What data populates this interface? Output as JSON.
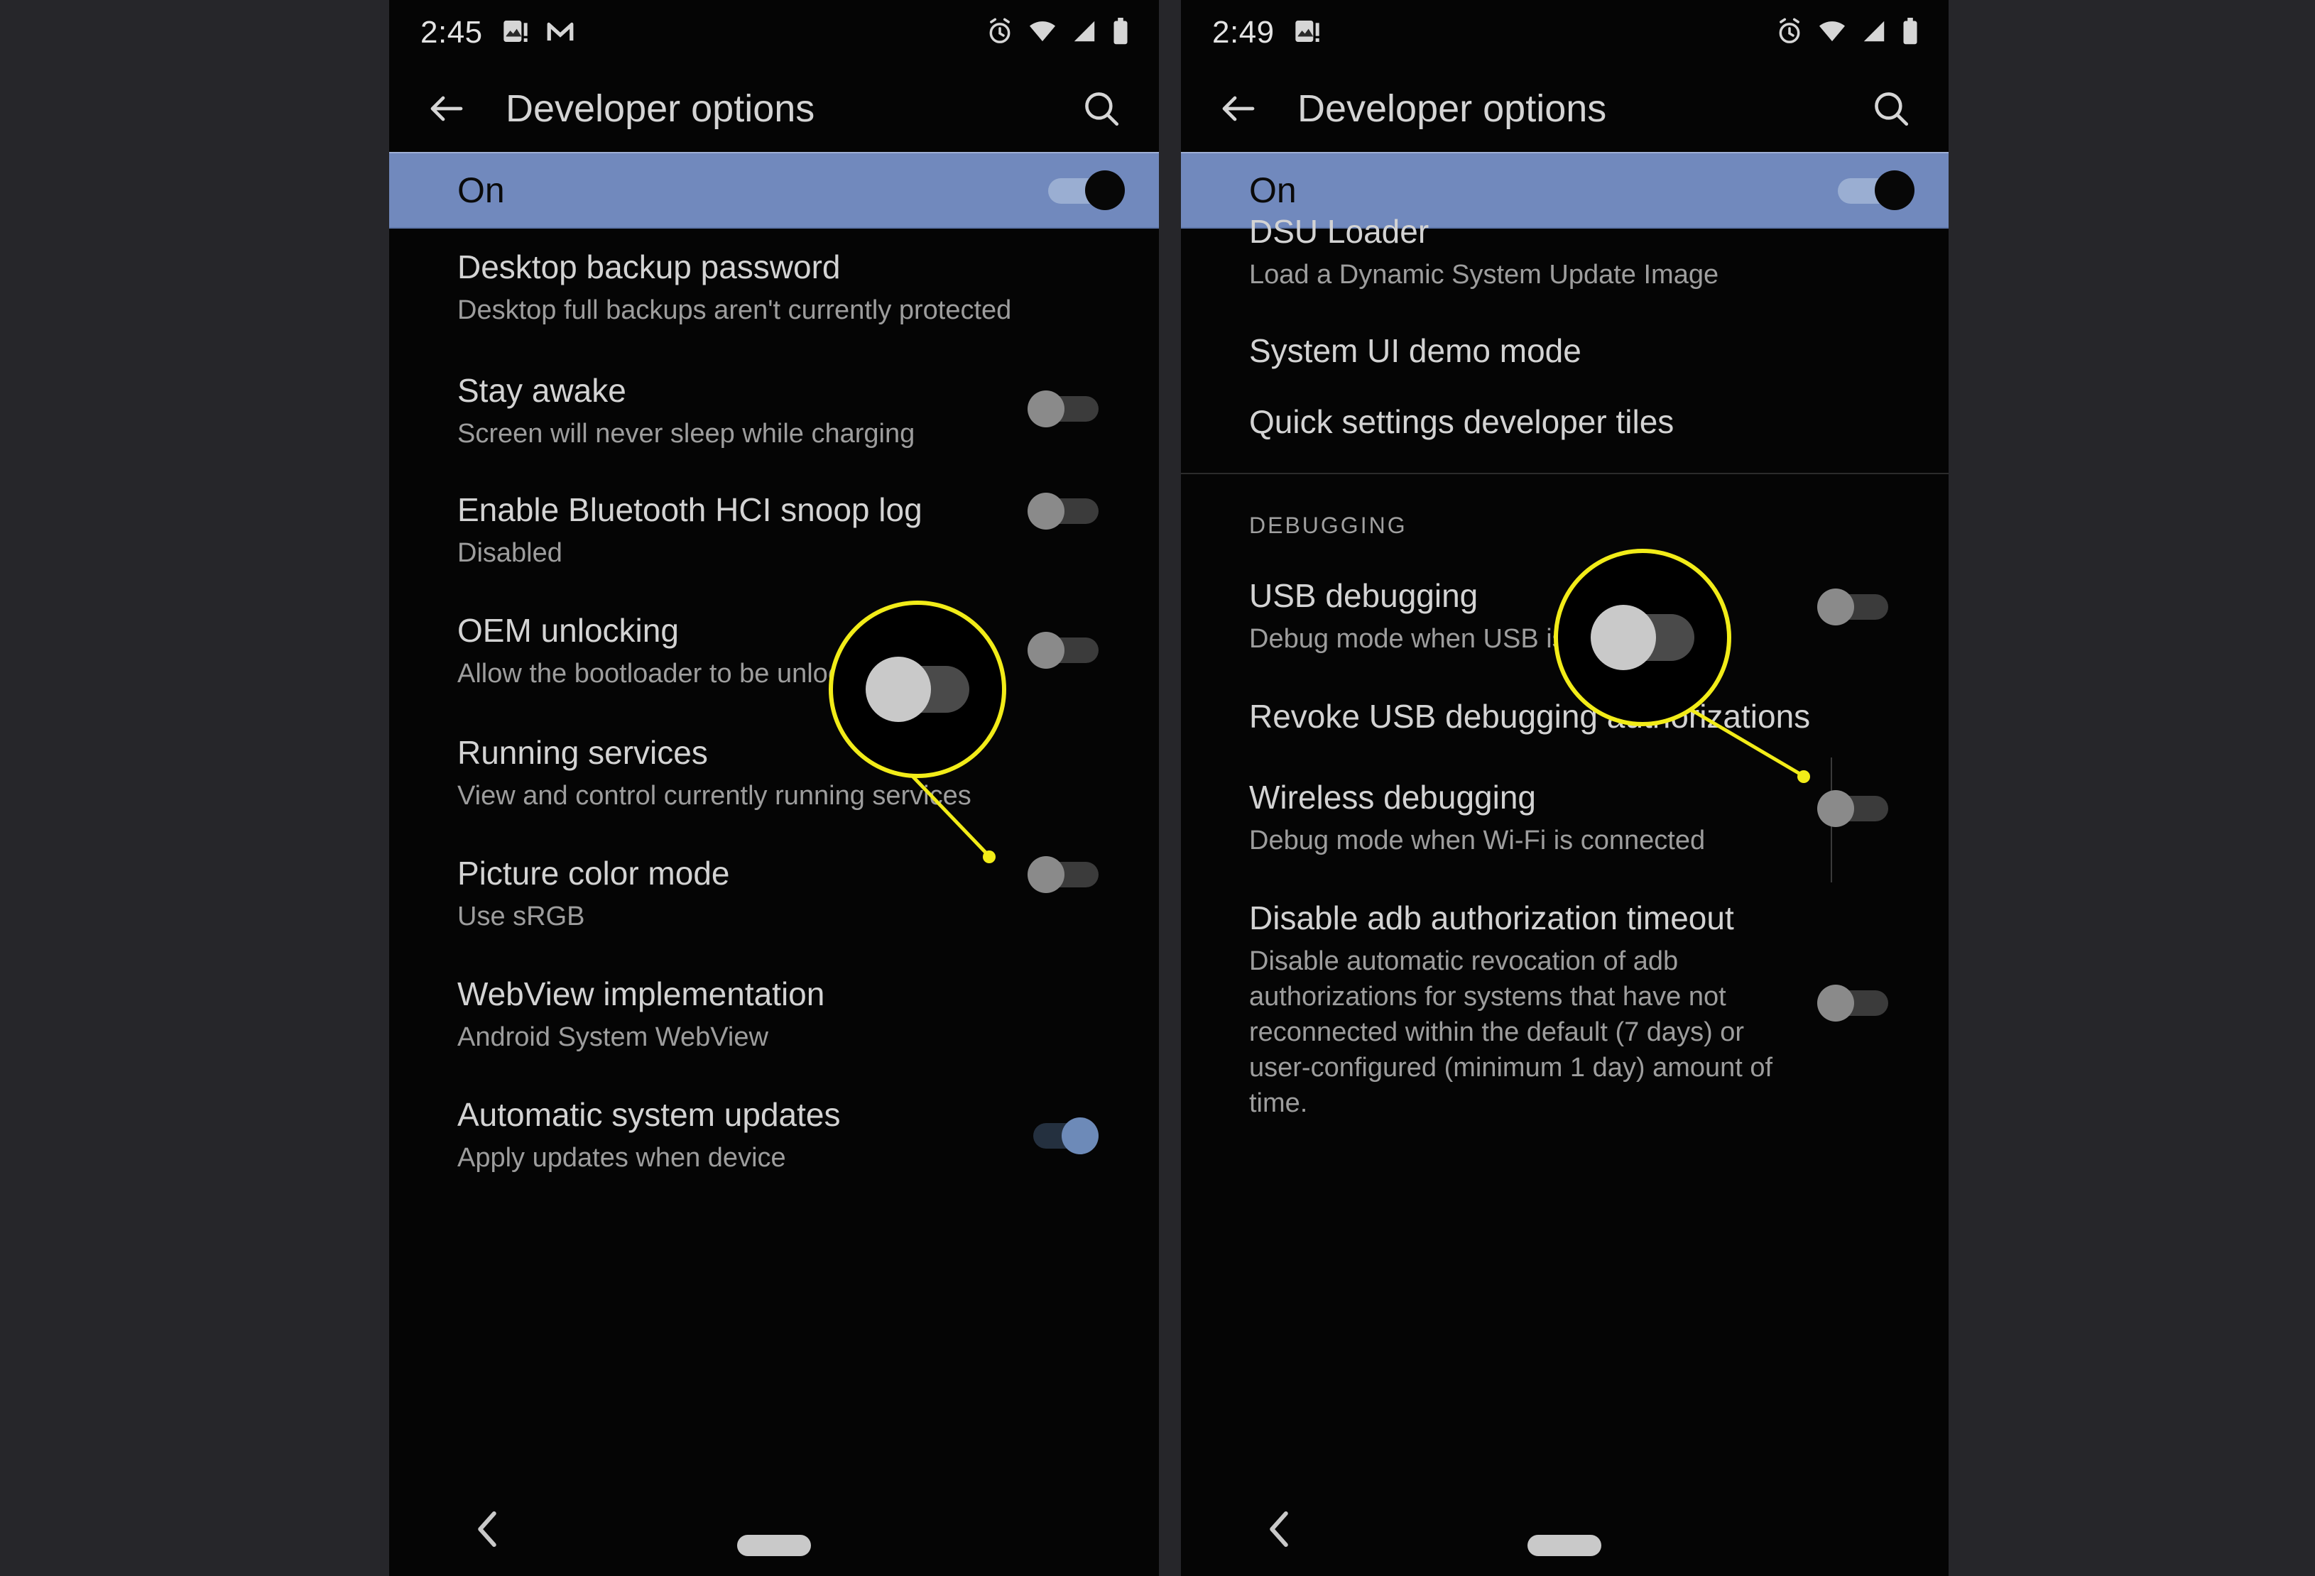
{
  "background_color": "#26262a",
  "accent_highlight": "#f2ec18",
  "master_bar_color": "#7189bd",
  "toggle_on_color": "#6d8ab8",
  "panels": [
    {
      "id": "left",
      "status_bar": {
        "time": "2:45",
        "left_icons": [
          "screenshot-icon",
          "gmail-icon"
        ],
        "right_icons": [
          "alarm-icon",
          "wifi-icon",
          "signal-icon",
          "battery-icon"
        ]
      },
      "action_bar": {
        "back_icon": "arrow-back-icon",
        "title": "Developer options",
        "search_icon": "search-icon"
      },
      "master_switch": {
        "label": "On",
        "state": "on"
      },
      "items": [
        {
          "title": "Desktop backup password",
          "summary": "Desktop full backups aren't currently protected",
          "switch": null
        },
        {
          "title": "Stay awake",
          "summary": "Screen will never sleep while charging",
          "switch": "off"
        },
        {
          "title": "Enable Bluetooth HCI snoop log",
          "summary": "Disabled",
          "switch": "off"
        },
        {
          "title": "OEM unlocking",
          "summary": "Allow the bootloader to be unlocked",
          "switch": "off"
        },
        {
          "title": "Running services",
          "summary": "View and control currently running services",
          "switch": null
        },
        {
          "title": "Picture color mode",
          "summary": "Use sRGB",
          "switch": "off"
        },
        {
          "title": "WebView implementation",
          "summary": "Android System WebView",
          "switch": null
        },
        {
          "title": "Automatic system updates",
          "summary": "Apply updates when device",
          "switch": "on"
        }
      ],
      "callout": {
        "magnified_switch_state": "off",
        "points_to": "OEM unlocking switch"
      },
      "nav_bar": {
        "back_icon": "nav-back-chevron-icon",
        "home_icon": "nav-home-pill-icon"
      }
    },
    {
      "id": "right",
      "status_bar": {
        "time": "2:49",
        "left_icons": [
          "screenshot-icon"
        ],
        "right_icons": [
          "alarm-icon",
          "wifi-icon",
          "signal-icon",
          "battery-icon"
        ]
      },
      "action_bar": {
        "back_icon": "arrow-back-icon",
        "title": "Developer options",
        "search_icon": "search-icon"
      },
      "master_switch": {
        "label": "On",
        "state": "on"
      },
      "items": [
        {
          "title": "DSU Loader",
          "summary": "Load a Dynamic System Update Image",
          "switch": null
        },
        {
          "title": "System UI demo mode",
          "summary": "",
          "switch": null
        },
        {
          "title": "Quick settings developer tiles",
          "summary": "",
          "switch": null
        }
      ],
      "section_header": "DEBUGGING",
      "debug_items": [
        {
          "title": "USB debugging",
          "summary": "Debug mode when USB is connected",
          "switch": "off"
        },
        {
          "title": "Revoke USB debugging authorizations",
          "summary": "",
          "switch": null
        },
        {
          "title": "Wireless debugging",
          "summary": "Debug mode when Wi-Fi is connected",
          "switch": "off",
          "has_vertical_divider": true
        },
        {
          "title": "Disable adb authorization timeout",
          "summary": "Disable automatic revocation of adb authorizations for systems that have not reconnected within the default (7 days) or user-configured (minimum 1 day) amount of time.",
          "switch": "off"
        }
      ],
      "callout": {
        "magnified_switch_state": "off",
        "points_to": "USB debugging switch"
      },
      "nav_bar": {
        "back_icon": "nav-back-chevron-icon",
        "home_icon": "nav-home-pill-icon"
      }
    }
  ]
}
